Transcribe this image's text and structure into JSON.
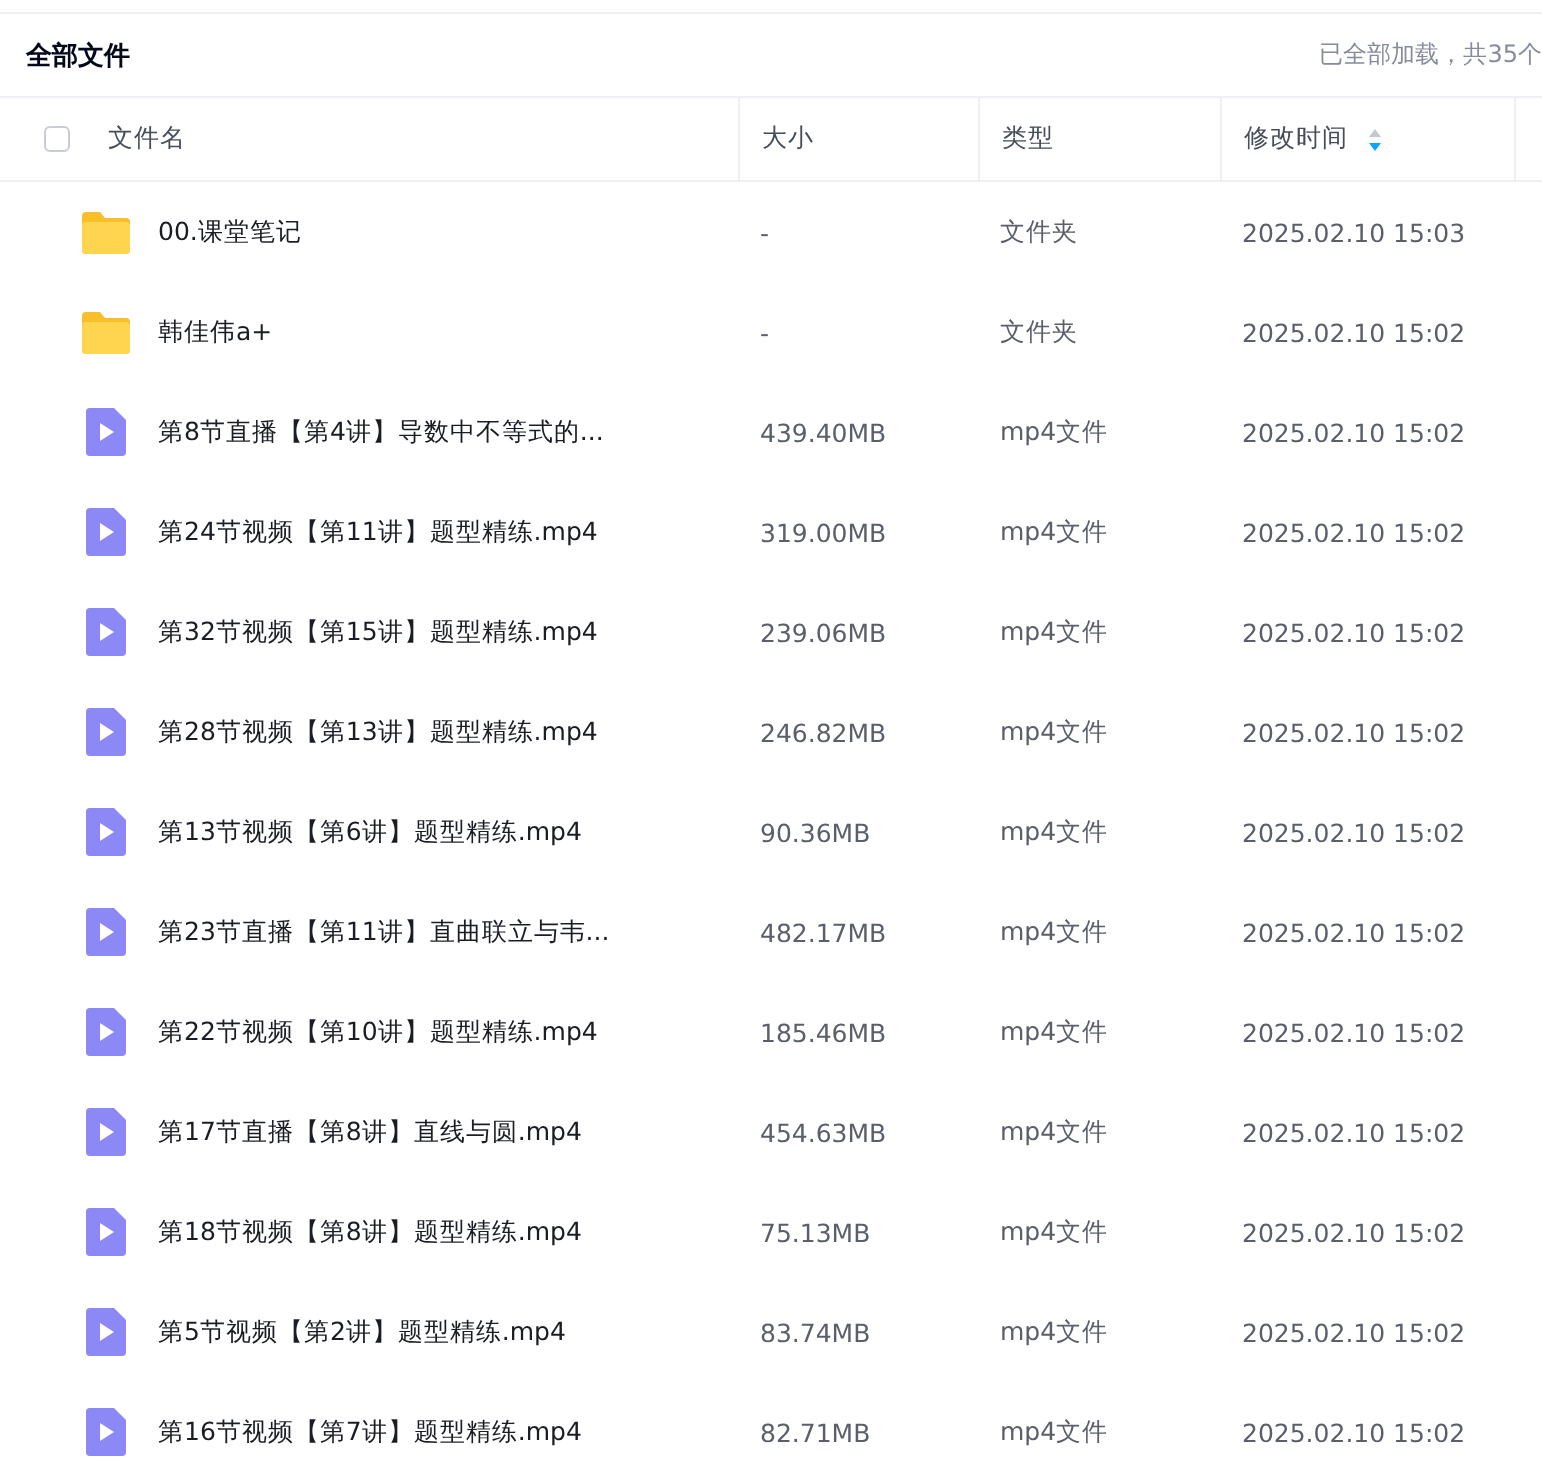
{
  "title": "全部文件",
  "load_status": "已全部加载，共35个",
  "select_all": {
    "checked": false
  },
  "columns": [
    {
      "label": "文件名"
    },
    {
      "label": "大小"
    },
    {
      "label": "类型"
    },
    {
      "label": "修改时间",
      "sorted_descending": true
    }
  ],
  "rows": [
    {
      "kind": "folder",
      "name": "00.课堂笔记",
      "size": "-",
      "type": "文件夹",
      "modified": "2025.02.10 15:03"
    },
    {
      "kind": "folder",
      "name": "韩佳伟a+",
      "size": "-",
      "type": "文件夹",
      "modified": "2025.02.10 15:02"
    },
    {
      "kind": "video",
      "name": "第8节直播【第4讲】导数中不等式的...",
      "size": "439.40MB",
      "type": "mp4文件",
      "modified": "2025.02.10 15:02"
    },
    {
      "kind": "video",
      "name": "第24节视频【第11讲】题型精练.mp4",
      "size": "319.00MB",
      "type": "mp4文件",
      "modified": "2025.02.10 15:02"
    },
    {
      "kind": "video",
      "name": "第32节视频【第15讲】题型精练.mp4",
      "size": "239.06MB",
      "type": "mp4文件",
      "modified": "2025.02.10 15:02"
    },
    {
      "kind": "video",
      "name": "第28节视频【第13讲】题型精练.mp4",
      "size": "246.82MB",
      "type": "mp4文件",
      "modified": "2025.02.10 15:02"
    },
    {
      "kind": "video",
      "name": "第13节视频【第6讲】题型精练.mp4",
      "size": "90.36MB",
      "type": "mp4文件",
      "modified": "2025.02.10 15:02"
    },
    {
      "kind": "video",
      "name": "第23节直播【第11讲】直曲联立与韦...",
      "size": "482.17MB",
      "type": "mp4文件",
      "modified": "2025.02.10 15:02"
    },
    {
      "kind": "video",
      "name": "第22节视频【第10讲】题型精练.mp4",
      "size": "185.46MB",
      "type": "mp4文件",
      "modified": "2025.02.10 15:02"
    },
    {
      "kind": "video",
      "name": "第17节直播【第8讲】直线与圆.mp4",
      "size": "454.63MB",
      "type": "mp4文件",
      "modified": "2025.02.10 15:02"
    },
    {
      "kind": "video",
      "name": "第18节视频【第8讲】题型精练.mp4",
      "size": "75.13MB",
      "type": "mp4文件",
      "modified": "2025.02.10 15:02"
    },
    {
      "kind": "video",
      "name": "第5节视频【第2讲】题型精练.mp4",
      "size": "83.74MB",
      "type": "mp4文件",
      "modified": "2025.02.10 15:02"
    },
    {
      "kind": "video",
      "name": "第16节视频【第7讲】题型精练.mp4",
      "size": "82.71MB",
      "type": "mp4文件",
      "modified": "2025.02.10 15:02"
    }
  ]
}
